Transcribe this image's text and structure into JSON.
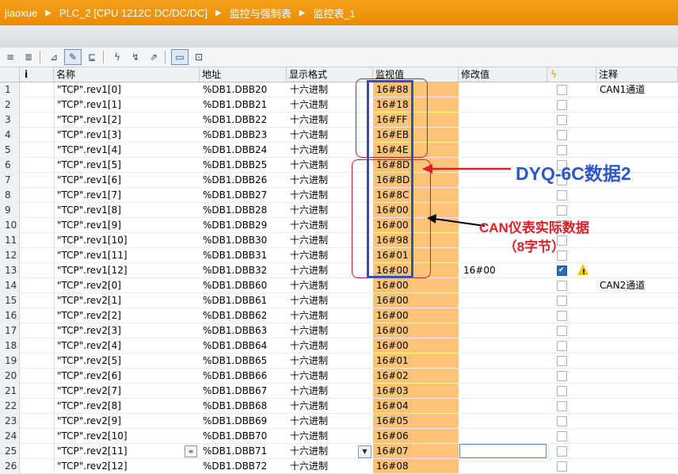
{
  "breadcrumb": [
    "jiaoxue",
    "PLC_2 [CPU 1212C DC/DC/DC]",
    "监控与强制表",
    "监控表_1"
  ],
  "toolbar": {
    "icons": [
      "insert-row-icon",
      "add-row-icon",
      "display-all-icon",
      "monitor-all-icon",
      "monitor-once-icon",
      "modify-now-icon",
      "modify-trigger-icon",
      "force-icon",
      "show-columns-icon",
      "expand-icon"
    ]
  },
  "columns": {
    "info_icon": "i",
    "name": "名称",
    "address": "地址",
    "display_format": "显示格式",
    "monitor_value": "监视值",
    "modify_value": "修改值",
    "modify_flag_icon": "lightning-icon",
    "comment": "注释"
  },
  "rows": [
    {
      "idx": "1",
      "name": "\"TCP\".rev1[0]",
      "addr": "%DB1.DBB20",
      "fmt": "十六进制",
      "mon": "16#88",
      "mod": "",
      "chk": false,
      "cmt": "CAN1通道"
    },
    {
      "idx": "2",
      "name": "\"TCP\".rev1[1]",
      "addr": "%DB1.DBB21",
      "fmt": "十六进制",
      "mon": "16#18",
      "mod": "",
      "chk": false,
      "cmt": ""
    },
    {
      "idx": "3",
      "name": "\"TCP\".rev1[2]",
      "addr": "%DB1.DBB22",
      "fmt": "十六进制",
      "mon": "16#FF",
      "mod": "",
      "chk": false,
      "cmt": ""
    },
    {
      "idx": "4",
      "name": "\"TCP\".rev1[3]",
      "addr": "%DB1.DBB23",
      "fmt": "十六进制",
      "mon": "16#EB",
      "mod": "",
      "chk": false,
      "cmt": ""
    },
    {
      "idx": "5",
      "name": "\"TCP\".rev1[4]",
      "addr": "%DB1.DBB24",
      "fmt": "十六进制",
      "mon": "16#4E",
      "mod": "",
      "chk": false,
      "cmt": ""
    },
    {
      "idx": "6",
      "name": "\"TCP\".rev1[5]",
      "addr": "%DB1.DBB25",
      "fmt": "十六进制",
      "mon": "16#8D",
      "mod": "",
      "chk": false,
      "cmt": ""
    },
    {
      "idx": "7",
      "name": "\"TCP\".rev1[6]",
      "addr": "%DB1.DBB26",
      "fmt": "十六进制",
      "mon": "16#8D",
      "mod": "",
      "chk": false,
      "cmt": ""
    },
    {
      "idx": "8",
      "name": "\"TCP\".rev1[7]",
      "addr": "%DB1.DBB27",
      "fmt": "十六进制",
      "mon": "16#8C",
      "mod": "",
      "chk": false,
      "cmt": ""
    },
    {
      "idx": "9",
      "name": "\"TCP\".rev1[8]",
      "addr": "%DB1.DBB28",
      "fmt": "十六进制",
      "mon": "16#00",
      "mod": "",
      "chk": false,
      "cmt": ""
    },
    {
      "idx": "10",
      "name": "\"TCP\".rev1[9]",
      "addr": "%DB1.DBB29",
      "fmt": "十六进制",
      "mon": "16#00",
      "mod": "",
      "chk": false,
      "cmt": ""
    },
    {
      "idx": "11",
      "name": "\"TCP\".rev1[10]",
      "addr": "%DB1.DBB30",
      "fmt": "十六进制",
      "mon": "16#98",
      "mod": "",
      "chk": false,
      "cmt": ""
    },
    {
      "idx": "12",
      "name": "\"TCP\".rev1[11]",
      "addr": "%DB1.DBB31",
      "fmt": "十六进制",
      "mon": "16#01",
      "mod": "",
      "chk": false,
      "cmt": ""
    },
    {
      "idx": "13",
      "name": "\"TCP\".rev1[12]",
      "addr": "%DB1.DBB32",
      "fmt": "十六进制",
      "mon": "16#00",
      "mod": "16#00",
      "chk": true,
      "warn": true,
      "cmt": ""
    },
    {
      "idx": "14",
      "name": "\"TCP\".rev2[0]",
      "addr": "%DB1.DBB60",
      "fmt": "十六进制",
      "mon": "16#00",
      "mod": "",
      "chk": false,
      "cmt": "CAN2通道"
    },
    {
      "idx": "15",
      "name": "\"TCP\".rev2[1]",
      "addr": "%DB1.DBB61",
      "fmt": "十六进制",
      "mon": "16#00",
      "mod": "",
      "chk": false,
      "cmt": ""
    },
    {
      "idx": "16",
      "name": "\"TCP\".rev2[2]",
      "addr": "%DB1.DBB62",
      "fmt": "十六进制",
      "mon": "16#00",
      "mod": "",
      "chk": false,
      "cmt": ""
    },
    {
      "idx": "17",
      "name": "\"TCP\".rev2[3]",
      "addr": "%DB1.DBB63",
      "fmt": "十六进制",
      "mon": "16#00",
      "mod": "",
      "chk": false,
      "cmt": ""
    },
    {
      "idx": "18",
      "name": "\"TCP\".rev2[4]",
      "addr": "%DB1.DBB64",
      "fmt": "十六进制",
      "mon": "16#00",
      "mod": "",
      "chk": false,
      "cmt": ""
    },
    {
      "idx": "19",
      "name": "\"TCP\".rev2[5]",
      "addr": "%DB1.DBB65",
      "fmt": "十六进制",
      "mon": "16#01",
      "mod": "",
      "chk": false,
      "cmt": ""
    },
    {
      "idx": "20",
      "name": "\"TCP\".rev2[6]",
      "addr": "%DB1.DBB66",
      "fmt": "十六进制",
      "mon": "16#02",
      "mod": "",
      "chk": false,
      "cmt": ""
    },
    {
      "idx": "21",
      "name": "\"TCP\".rev2[7]",
      "addr": "%DB1.DBB67",
      "fmt": "十六进制",
      "mon": "16#03",
      "mod": "",
      "chk": false,
      "cmt": ""
    },
    {
      "idx": "22",
      "name": "\"TCP\".rev2[8]",
      "addr": "%DB1.DBB68",
      "fmt": "十六进制",
      "mon": "16#04",
      "mod": "",
      "chk": false,
      "cmt": ""
    },
    {
      "idx": "23",
      "name": "\"TCP\".rev2[9]",
      "addr": "%DB1.DBB69",
      "fmt": "十六进制",
      "mon": "16#05",
      "mod": "",
      "chk": false,
      "cmt": ""
    },
    {
      "idx": "24",
      "name": "\"TCP\".rev2[10]",
      "addr": "%DB1.DBB70",
      "fmt": "十六进制",
      "mon": "16#06",
      "mod": "",
      "chk": false,
      "cmt": ""
    },
    {
      "idx": "25",
      "name": "\"TCP\".rev2[11]",
      "addr": "%DB1.DBB71",
      "fmt": "十六进制",
      "mon": "16#07",
      "mod": "",
      "chk": false,
      "cmt": "",
      "selected": true
    },
    {
      "idx": "26",
      "name": "\"TCP\".rev2[12]",
      "addr": "%DB1.DBB72",
      "fmt": "十六进制",
      "mon": "16#08",
      "mod": "",
      "chk": false,
      "cmt": ""
    }
  ],
  "annotations": {
    "label_dyq": "DYQ-6C数据2",
    "label_can_line1": "CAN仪表实际数据",
    "label_can_line2": "（8字节）",
    "color_red": "#c8202c",
    "color_blue": "#2e57c7"
  }
}
